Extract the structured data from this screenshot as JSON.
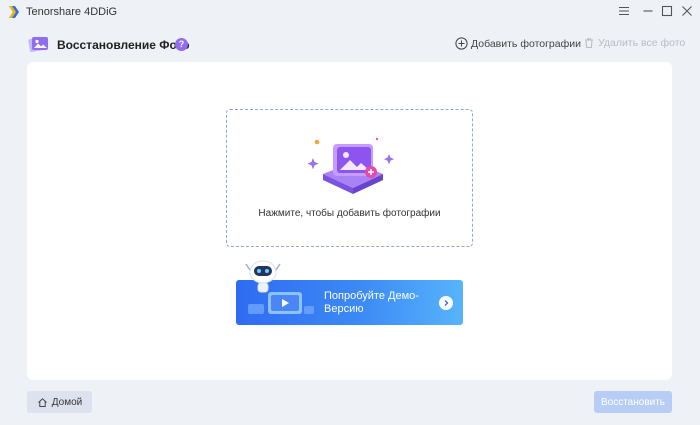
{
  "window": {
    "title": "Tenorshare 4DDiG"
  },
  "header": {
    "title": "Восстановление Фото",
    "help_label": "?",
    "add_photos_label": "Добавить фотографии",
    "delete_all_label": "Удалить все фото"
  },
  "dropzone": {
    "hint": "Нажмите, чтобы добавить фотографии"
  },
  "demo": {
    "label": "Попробуйте Демо-Версию"
  },
  "footer": {
    "home_label": "Домой",
    "restore_label": "Восстановить"
  },
  "colors": {
    "accent": "#2f6bf2",
    "accent_light": "#57b4fb",
    "purple": "#8f6cf0",
    "restore_disabled": "#b7cdf6",
    "background": "#eef1f6"
  }
}
